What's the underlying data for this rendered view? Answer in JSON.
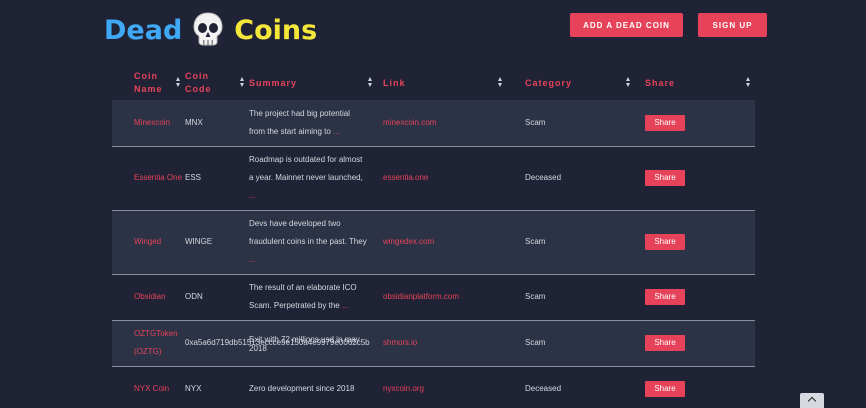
{
  "logo": {
    "word1": "Dead",
    "word2": "Coins",
    "icon": "skull-icon"
  },
  "header": {
    "add_label": "ADD A DEAD COIN",
    "signup_label": "SIGN UP"
  },
  "table": {
    "columns": {
      "name": [
        "Coin",
        "Name"
      ],
      "code": [
        "Coin",
        "Code"
      ],
      "summary": "Summary",
      "link": "Link",
      "category": "Category",
      "share": "Share"
    },
    "rows": [
      {
        "name": "Minexcoin",
        "code": "MNX",
        "summary": "The project had big potential from the start aiming to",
        "more": "...",
        "link": "minexcoin.com",
        "category": "Scam",
        "share": "Share"
      },
      {
        "name": "Essentia One",
        "code": "ESS",
        "summary": "Roadmap is outdated for almost a year. Mainnet never launched,",
        "more": "...",
        "link": "essentia.one",
        "category": "Deceased",
        "share": "Share"
      },
      {
        "name": "Winged",
        "code": "WINGE",
        "summary": "Devs have developed two fraudulent coins in the past. They",
        "more": "...",
        "link": "wingedex.com",
        "category": "Scam",
        "share": "Share"
      },
      {
        "name": "Obsidian",
        "code": "ODN",
        "summary": "The result of an elaborate ICO Scam. Perpetrated by the",
        "more": "...",
        "link": "obsidianplatform.com",
        "category": "Scam",
        "share": "Share"
      },
      {
        "name": "OZTGToken (OZTG)",
        "code": "0xa5a6d719db51513eccce9e150a4e9979e0062c5b",
        "summary": "Exit with 72 millions usd in may 2018",
        "more": "",
        "link": "shmoni.io",
        "category": "Scam",
        "share": "Share"
      },
      {
        "name": "NYX Coin",
        "code": "NYX",
        "summary": "Zero development since 2018",
        "more": "",
        "link": "nyxcoin.org",
        "category": "Deceased",
        "share": "Share"
      }
    ]
  },
  "colors": {
    "background": "#1f2335",
    "row_alt": "#2c3346",
    "accent": "#e6435a",
    "logo_blue": "#3fa9f5",
    "logo_yellow": "#f5e63a"
  }
}
